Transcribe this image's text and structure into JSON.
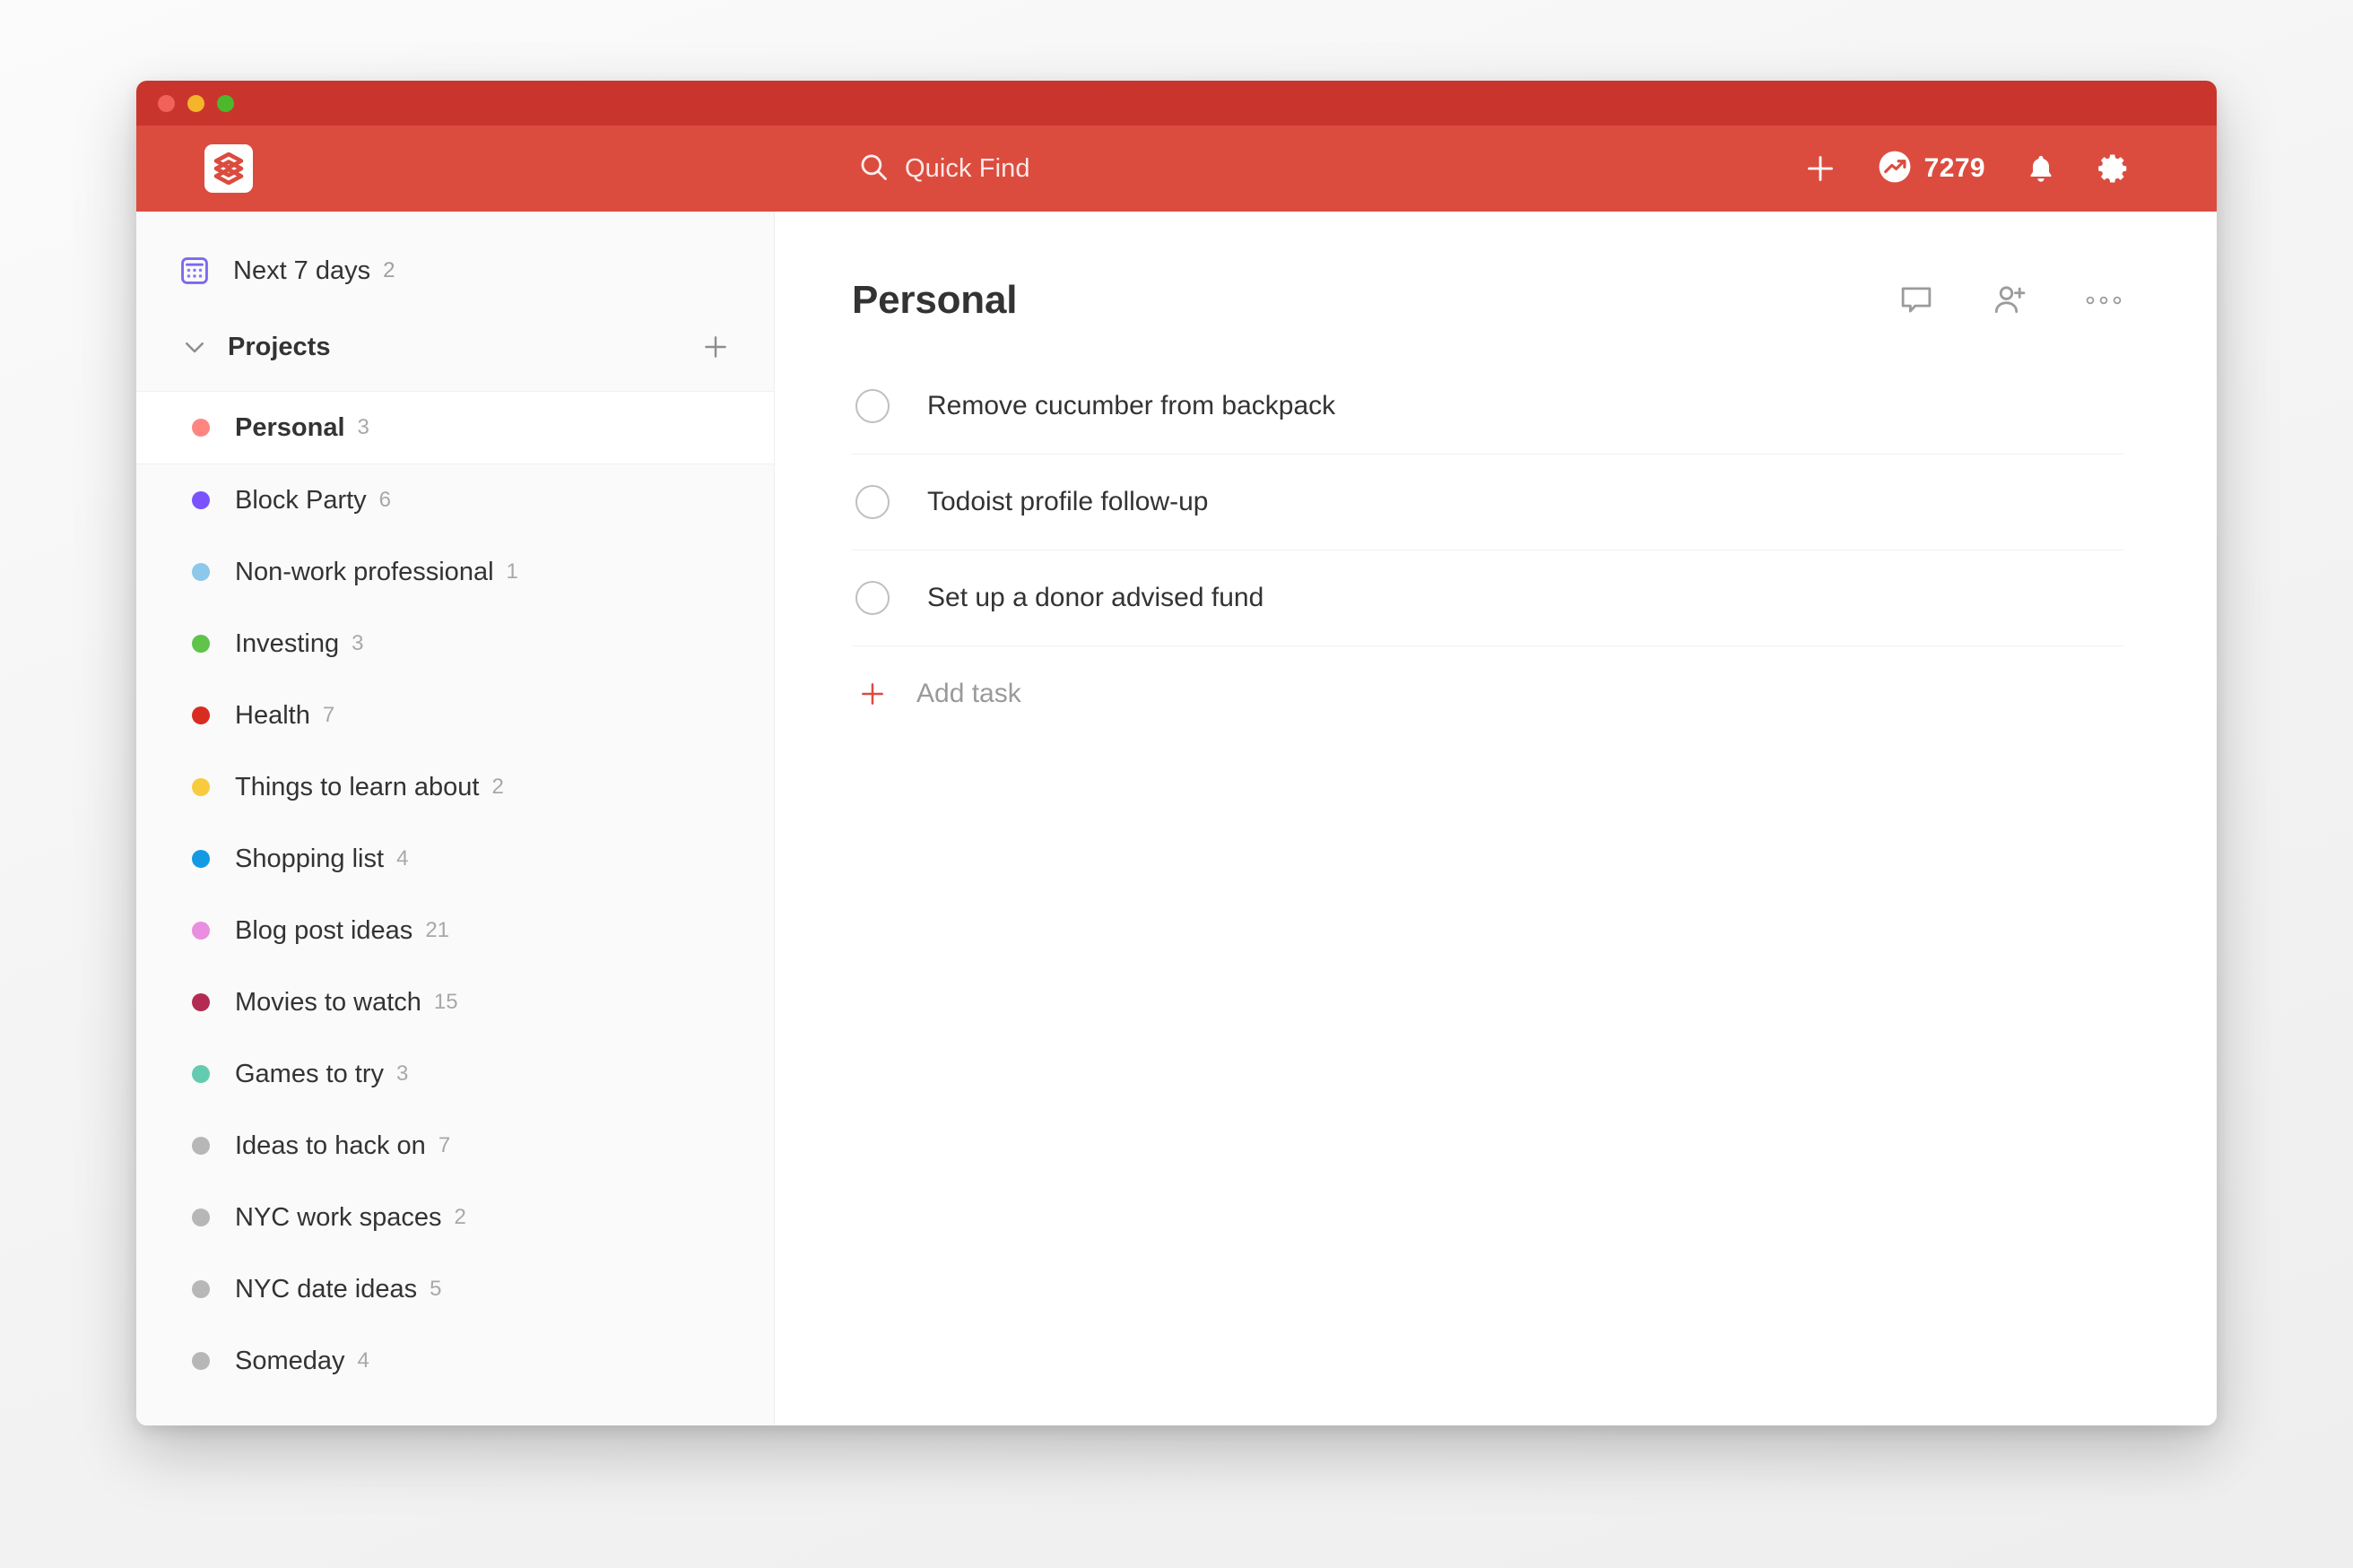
{
  "window": {
    "traffic_lights": [
      "close",
      "minimize",
      "zoom"
    ],
    "titlebar_color": "#c9352c",
    "toolbar_color": "#db4c3f"
  },
  "toolbar": {
    "logo_name": "todoist-logo",
    "search": {
      "placeholder": "Quick Find",
      "value": "",
      "icon": "search-icon"
    },
    "add_icon": "plus-icon",
    "karma": {
      "icon": "karma-trend-icon",
      "points": "7279"
    },
    "notifications_icon": "bell-icon",
    "settings_icon": "gear-icon"
  },
  "sidebar": {
    "nav": [
      {
        "label": "Next 7 days",
        "count": "2",
        "icon": "calendar-grid-icon",
        "icon_color": "#7b68ee"
      }
    ],
    "projects_section": {
      "title": "Projects",
      "collapse_icon": "chevron-down-icon",
      "add_icon": "plus-icon"
    },
    "projects": [
      {
        "label": "Personal",
        "count": "3",
        "color": "#ff8581",
        "selected": true
      },
      {
        "label": "Block Party",
        "count": "6",
        "color": "#7a52ff",
        "selected": false
      },
      {
        "label": "Non-work professional",
        "count": "1",
        "color": "#8dc7ea",
        "selected": false
      },
      {
        "label": "Investing",
        "count": "3",
        "color": "#5ec44a",
        "selected": false
      },
      {
        "label": "Health",
        "count": "7",
        "color": "#d82c20",
        "selected": false
      },
      {
        "label": "Things to learn about",
        "count": "2",
        "color": "#f7cb3d",
        "selected": false
      },
      {
        "label": "Shopping list",
        "count": "4",
        "color": "#129ae4",
        "selected": false
      },
      {
        "label": "Blog post ideas",
        "count": "21",
        "color": "#e98ee0",
        "selected": false
      },
      {
        "label": "Movies to watch",
        "count": "15",
        "color": "#b32b53",
        "selected": false
      },
      {
        "label": "Games to try",
        "count": "3",
        "color": "#64cbb0",
        "selected": false
      },
      {
        "label": "Ideas to hack on",
        "count": "7",
        "color": "#b7b7b7",
        "selected": false
      },
      {
        "label": "NYC work spaces",
        "count": "2",
        "color": "#b7b7b7",
        "selected": false
      },
      {
        "label": "NYC date ideas",
        "count": "5",
        "color": "#b7b7b7",
        "selected": false
      },
      {
        "label": "Someday",
        "count": "4",
        "color": "#b7b7b7",
        "selected": false
      }
    ]
  },
  "main": {
    "title": "Personal",
    "actions": [
      {
        "name": "comments-icon"
      },
      {
        "name": "add-person-icon"
      },
      {
        "name": "more-options-icon"
      }
    ],
    "tasks": [
      {
        "text": "Remove cucumber from backpack",
        "done": false
      },
      {
        "text": "Todoist profile follow-up",
        "done": false
      },
      {
        "text": "Set up a donor advised fund",
        "done": false
      }
    ],
    "add_task": {
      "label": "Add task",
      "icon": "plus-icon",
      "accent": "#db4c3f"
    }
  }
}
